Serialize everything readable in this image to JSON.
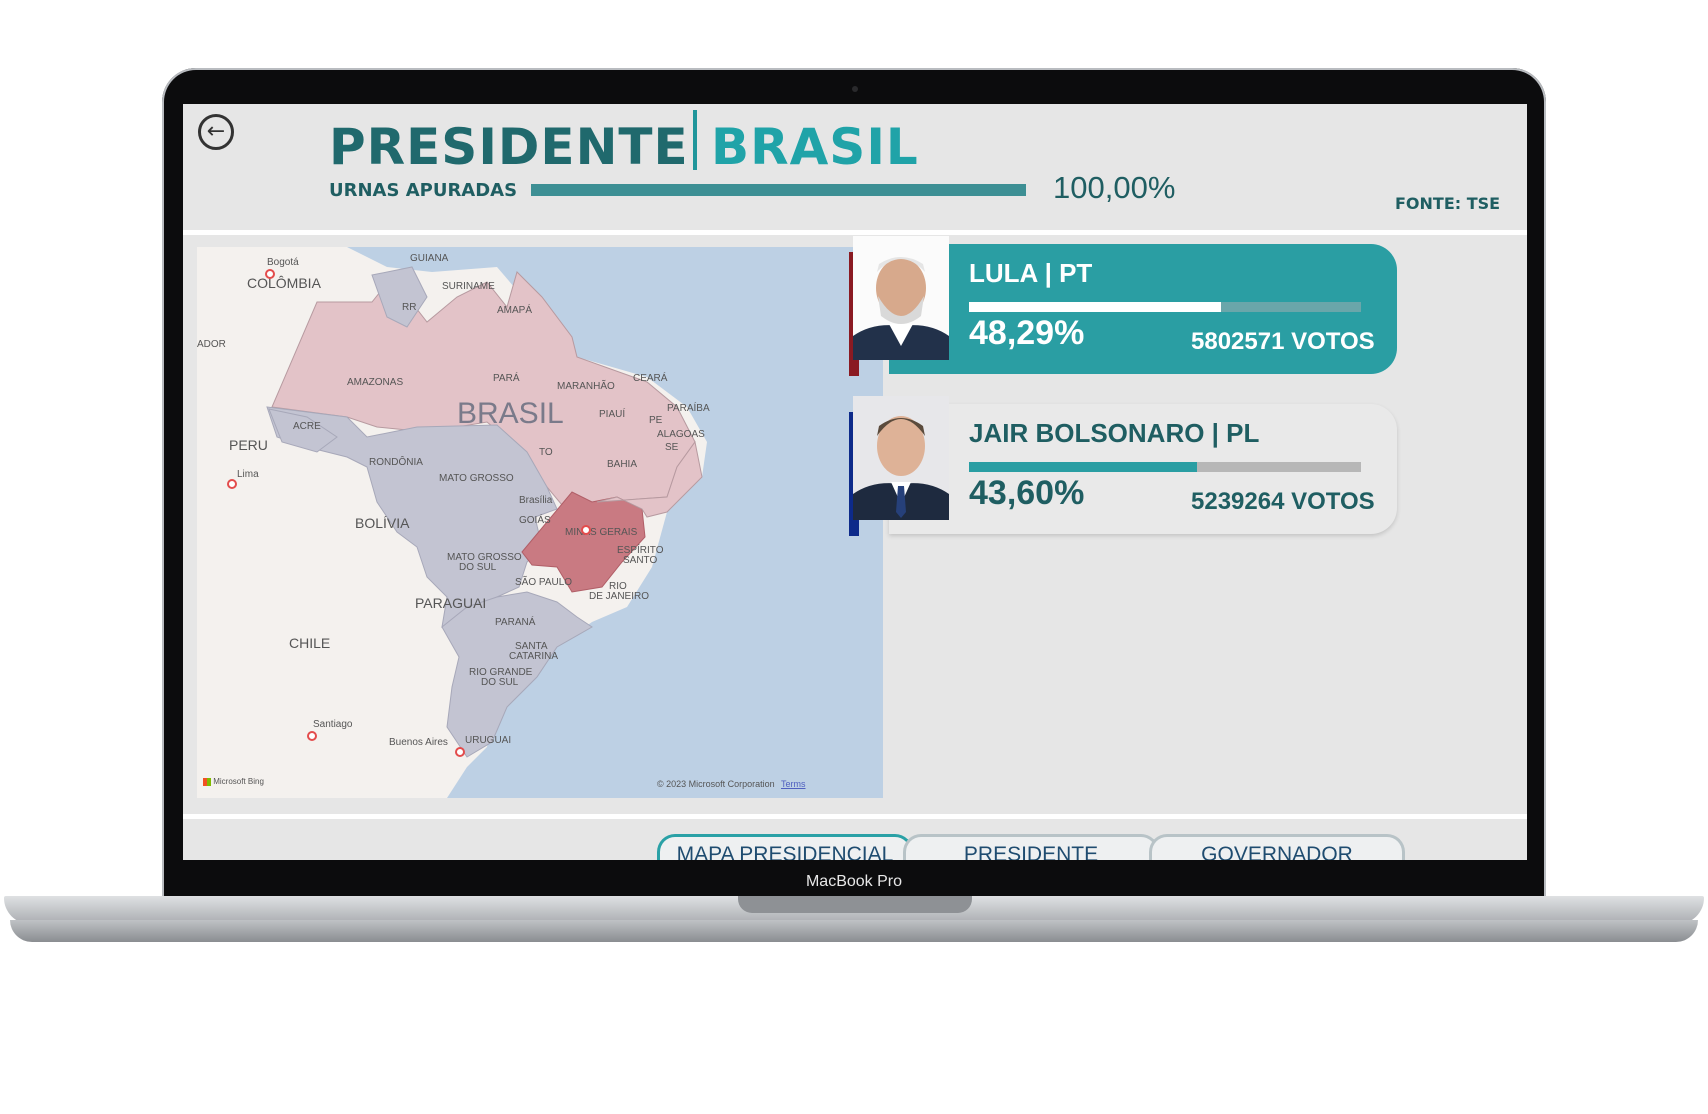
{
  "device": {
    "model_label": "MacBook Pro"
  },
  "header": {
    "title_left": "PRESIDENTE",
    "title_right": "BRASIL",
    "urnas_label": "URNAS APURADAS",
    "urnas_progress": 1.0,
    "urnas_value": "100,00%",
    "source": "FONTE: TSE"
  },
  "map": {
    "attribution_brand": "Microsoft Bing",
    "copyright": "© 2023 Microsoft Corporation",
    "terms": "Terms",
    "labels": {
      "bogota": "Bogotá",
      "colombia": "COLÔMBIA",
      "guiana": "GUIANA",
      "suriname": "SURINAME",
      "amapa": "AMAPÁ",
      "rr": "RR",
      "equador": "ADOR",
      "amazonas": "AMAZONAS",
      "para": "PARÁ",
      "maranhao": "MARANHÃO",
      "ceara": "CEARÁ",
      "paraiba": "PARAÍBA",
      "piaui": "PIAUÍ",
      "pe": "PE",
      "alagoas": "ALAGOAS",
      "se": "SE",
      "brasil": "BRASIL",
      "acre": "ACRE",
      "peru": "PERU",
      "lima": "Lima",
      "rondonia": "RONDÔNIA",
      "to": "TO",
      "bahia": "BAHIA",
      "mato_grosso": "MATO GROSSO",
      "brasilia": "Brasília",
      "goias": "GOIÁS",
      "minas_gerais": "MINAS GERAIS",
      "bolivia": "BOLÍVIA",
      "mato_grosso_sul_1": "MATO GROSSO",
      "mato_grosso_sul_2": "DO SUL",
      "espirito_santo_1": "ESPÍRITO",
      "espirito_santo_2": "SANTO",
      "sao_paulo": "SÃO PAULO",
      "rio_1": "RIO",
      "rio_2": "DE JANEIRO",
      "paraguai": "PARAGUAI",
      "parana": "PARANÁ",
      "chile": "CHILE",
      "santa_catarina_1": "SANTA",
      "santa_catarina_2": "CATARINA",
      "rio_grande_1": "RIO GRANDE",
      "rio_grande_2": "DO SUL",
      "santiago": "Santiago",
      "buenos_aires": "Buenos Aires",
      "uruguai": "URUGUAI"
    }
  },
  "candidates": [
    {
      "name": "LULA | PT",
      "percent": "48,29%",
      "share": 0.4829,
      "votes": "5802571",
      "votes_unit": "VOTOS",
      "color": "#2a9ea3",
      "accent": "#8a1a22"
    },
    {
      "name": "JAIR BOLSONARO | PL",
      "percent": "43,60%",
      "share": 0.436,
      "votes": "5239264",
      "votes_unit": "VOTOS",
      "color": "#e9e9e9",
      "accent": "#0d2a8a"
    }
  ],
  "tabs": [
    {
      "label": "MAPA PRESIDENCIAL",
      "active": true
    },
    {
      "label": "PRESIDENTE",
      "active": false
    },
    {
      "label": "GOVERNADOR",
      "active": false
    }
  ]
}
